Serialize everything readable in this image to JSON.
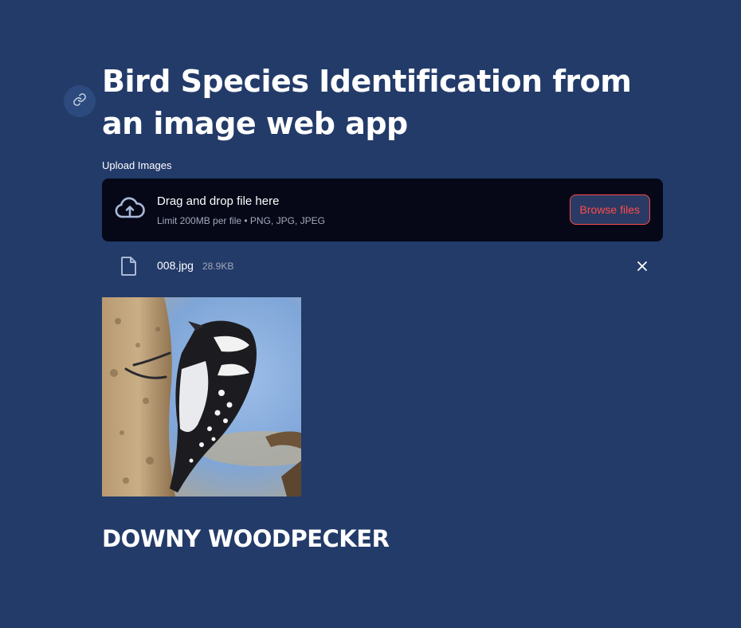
{
  "page": {
    "title": "Bird Species Identification from an image web app",
    "anchor_icon": "link-icon"
  },
  "uploader": {
    "label": "Upload Images",
    "drop_title": "Drag and drop file here",
    "drop_hint": "Limit 200MB per file • PNG, JPG, JPEG",
    "browse_label": "Browse files",
    "icon": "cloud-upload-icon"
  },
  "uploaded_file": {
    "name": "008.jpg",
    "size": "28.9KB",
    "icon": "file-icon",
    "remove_icon": "close-icon"
  },
  "prediction": {
    "label": "DOWNY WOODPECKER"
  },
  "colors": {
    "background": "#233b69",
    "dropzone": "#060818",
    "accent": "#ff4b4b",
    "muted_text": "#a3a8b8"
  }
}
